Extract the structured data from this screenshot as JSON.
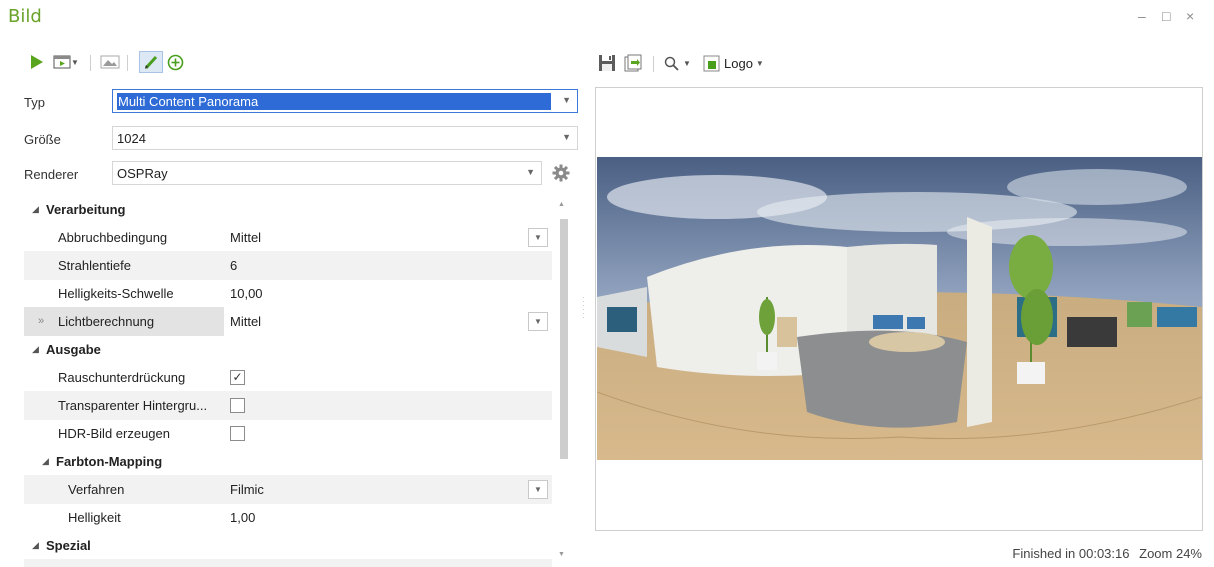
{
  "window": {
    "title": "Bild",
    "minimize": "–",
    "maximize": "□",
    "close": "×"
  },
  "left_toolbar": {
    "icons": [
      "play-icon",
      "render-preview-icon",
      "image-strip-icon",
      "edit-pen-icon",
      "add-circle-icon"
    ],
    "colors": {
      "play": "#5aa51f",
      "pen": "#4a9e1e",
      "add": "#4a9e1e"
    }
  },
  "form": {
    "typ": {
      "label": "Typ",
      "value": "Multi Content Panorama"
    },
    "groesse": {
      "label": "Größe",
      "value": "1024"
    },
    "renderer": {
      "label": "Renderer",
      "value": "OSPRay"
    }
  },
  "properties": {
    "verarbeitung": {
      "label": "Verarbeitung",
      "abbruch": {
        "name": "Abbruchbedingung",
        "value": "Mittel"
      },
      "strahlentiefe": {
        "name": "Strahlentiefe",
        "value": "6"
      },
      "helligkeits_schwelle": {
        "name": "Helligkeits-Schwelle",
        "value": "10,00"
      },
      "lichtberechnung": {
        "name": "Lichtberechnung",
        "value": "Mittel",
        "expander": "»"
      }
    },
    "ausgabe": {
      "label": "Ausgabe",
      "rausch": {
        "name": "Rauschunterdrückung",
        "checked": true
      },
      "transparent": {
        "name": "Transparenter Hintergru...",
        "checked": false
      },
      "hdr": {
        "name": "HDR-Bild erzeugen",
        "checked": false
      }
    },
    "farbton": {
      "label": "Farbton-Mapping",
      "verfahren": {
        "name": "Verfahren",
        "value": "Filmic"
      },
      "helligkeit": {
        "name": "Helligkeit",
        "value": "1,00"
      }
    },
    "spezial": {
      "label": "Spezial"
    },
    "check_mark": "✓"
  },
  "right_toolbar": {
    "icons": [
      "save-icon",
      "export-icon",
      "zoom-icon",
      "logo-icon"
    ],
    "logo_label": "Logo"
  },
  "status": {
    "finished": "Finished in 00:03:16",
    "zoom": "Zoom 24%"
  }
}
